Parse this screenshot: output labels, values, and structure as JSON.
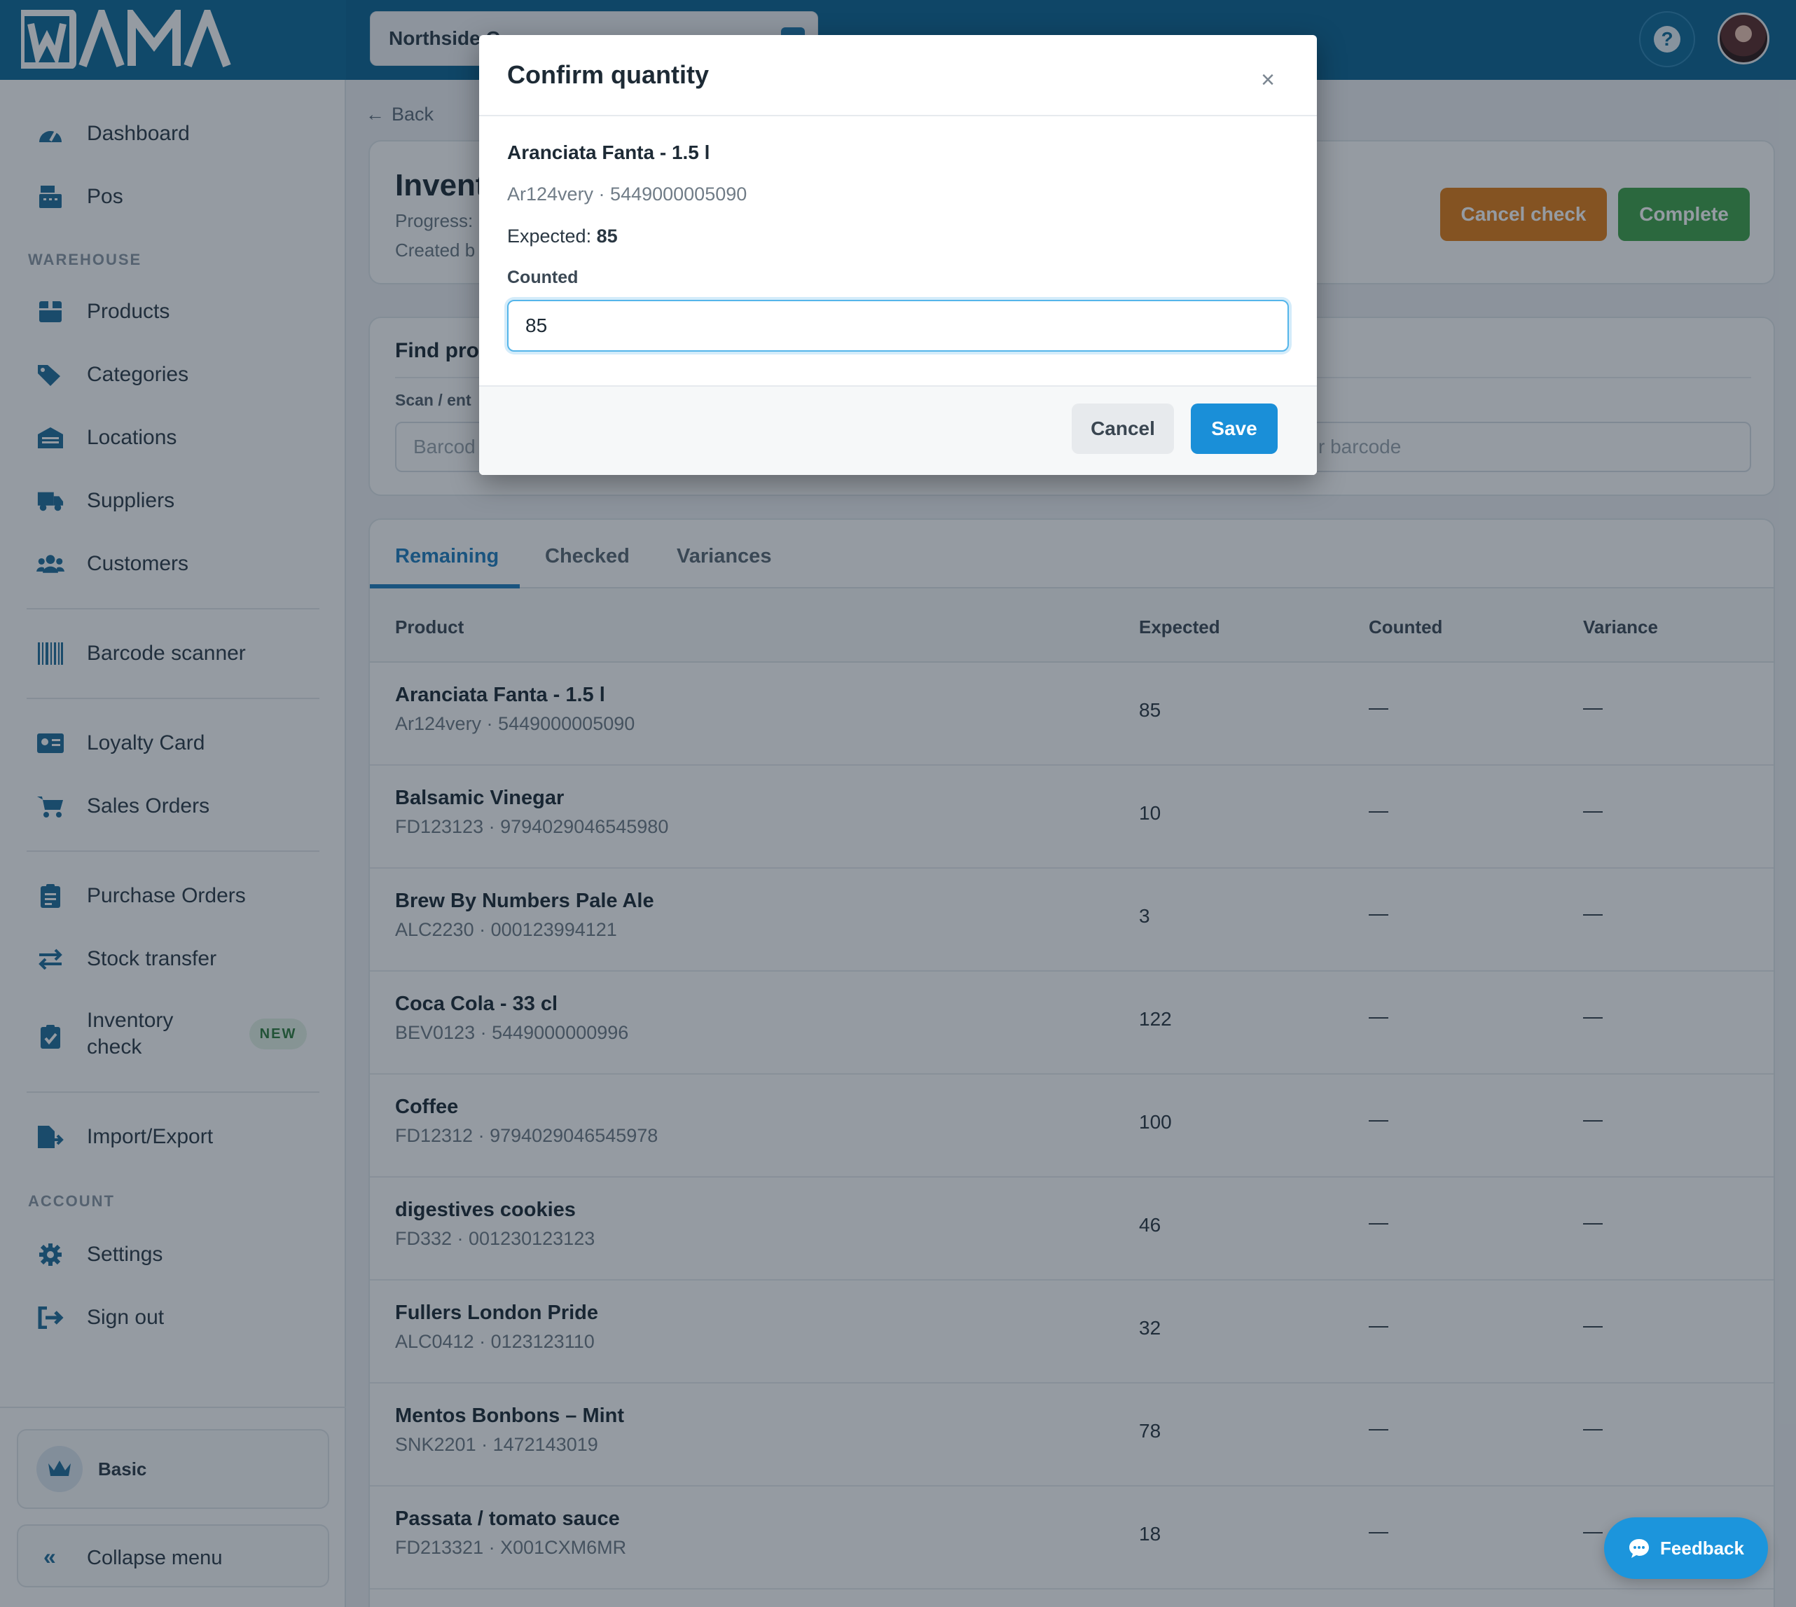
{
  "app": {
    "brand": "WAMA"
  },
  "header": {
    "store_select_value": "Northside C",
    "help_icon": "question-circle-icon",
    "avatar_icon": "user-avatar"
  },
  "sidebar": {
    "items_top": [
      {
        "label": "Dashboard",
        "icon": "speedometer-icon"
      },
      {
        "label": "Pos",
        "icon": "cash-register-icon"
      }
    ],
    "section_warehouse": "WAREHOUSE",
    "items_warehouse": [
      {
        "label": "Products",
        "icon": "box-icon"
      },
      {
        "label": "Categories",
        "icon": "tags-icon"
      },
      {
        "label": "Locations",
        "icon": "warehouse-icon"
      },
      {
        "label": "Suppliers",
        "icon": "truck-icon"
      },
      {
        "label": "Customers",
        "icon": "users-icon"
      }
    ],
    "barcode_scanner": "Barcode scanner",
    "loyalty_card": "Loyalty Card",
    "sales_orders": "Sales Orders",
    "purchase_orders": "Purchase Orders",
    "stock_transfer": "Stock transfer",
    "inventory_check_line1": "Inventory",
    "inventory_check_line2": "check",
    "new_badge": "NEW",
    "import_export": "Import/Export",
    "section_account": "ACCOUNT",
    "settings": "Settings",
    "sign_out": "Sign out",
    "plan": "Basic",
    "collapse": "Collapse menu"
  },
  "main": {
    "back": "Back",
    "inventory_title": "Invent",
    "progress_label": "Progress:",
    "created_label": "Created b",
    "cancel_check": "Cancel check",
    "complete": "Complete",
    "find_title": "Find pro",
    "scan_label": "Scan / ent",
    "scan_placeholder_left": "Barcod",
    "scan_placeholder_right": "r barcode",
    "tabs": [
      "Remaining",
      "Checked",
      "Variances"
    ],
    "columns": [
      "Product",
      "Expected",
      "Counted",
      "Variance"
    ],
    "rows": [
      {
        "name": "Aranciata Fanta - 1.5 l",
        "sub": "Ar124very · 5449000005090",
        "expected": "85",
        "counted": "—",
        "variance": "—"
      },
      {
        "name": "Balsamic Vinegar",
        "sub": "FD123123 · 9794029046545980",
        "expected": "10",
        "counted": "—",
        "variance": "—"
      },
      {
        "name": "Brew By Numbers Pale Ale",
        "sub": "ALC2230 · 000123994121",
        "expected": "3",
        "counted": "—",
        "variance": "—"
      },
      {
        "name": "Coca Cola - 33 cl",
        "sub": "BEV0123 · 5449000000996",
        "expected": "122",
        "counted": "—",
        "variance": "—"
      },
      {
        "name": "Coffee",
        "sub": "FD12312 · 9794029046545978",
        "expected": "100",
        "counted": "—",
        "variance": "—"
      },
      {
        "name": "digestives cookies",
        "sub": "FD332 · 001230123123",
        "expected": "46",
        "counted": "—",
        "variance": "—"
      },
      {
        "name": "Fullers London Pride",
        "sub": "ALC0412 · 0123123110",
        "expected": "32",
        "counted": "—",
        "variance": "—"
      },
      {
        "name": "Mentos Bonbons – Mint",
        "sub": "SNK2201 · 1472143019",
        "expected": "78",
        "counted": "—",
        "variance": "—"
      },
      {
        "name": "Passata / tomato sauce",
        "sub": "FD213321 · X001CXM6MR",
        "expected": "18",
        "counted": "—",
        "variance": "—"
      }
    ]
  },
  "modal": {
    "title": "Confirm quantity",
    "product_name": "Aranciata Fanta - 1.5 l",
    "product_sub": "Ar124very · 5449000005090",
    "expected_label": "Expected:",
    "expected_value": "85",
    "counted_label": "Counted",
    "counted_value": "85",
    "cancel": "Cancel",
    "save": "Save"
  },
  "feedback": "Feedback",
  "colors": {
    "header": "#0b6594",
    "accent": "#1a8fd8",
    "cancel_check": "#e07d16",
    "complete": "#3fa24a"
  }
}
